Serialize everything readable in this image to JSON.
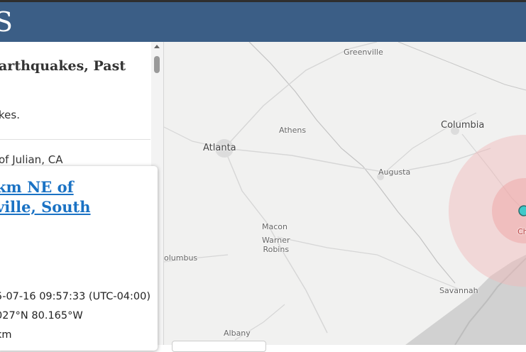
{
  "header": {
    "logo_text": "S"
  },
  "sidebar": {
    "list_title": "arthquakes, Past",
    "list_description": "kes.",
    "list_item": "of Julian, CA"
  },
  "popup": {
    "title_line1": "km NE of",
    "title_line2": "ville, South",
    "time": "5-07-16 09:57:33 (UTC-04:00)",
    "location": "027°N 80.165°W",
    "depth": "km"
  },
  "map": {
    "labels": {
      "greenville": "Greenville",
      "athens": "Athens",
      "columbia": "Columbia",
      "atlanta": "Atlanta",
      "augusta": "Augusta",
      "macon": "Macon",
      "warner_robins": "Warner\nRobins",
      "columbus": "olumbus",
      "savannah": "Savannah",
      "albany": "Albany",
      "charleston_partial": "Ch"
    },
    "marker_color": "#3fc9c9",
    "radius_color": "#f2b7b7"
  }
}
